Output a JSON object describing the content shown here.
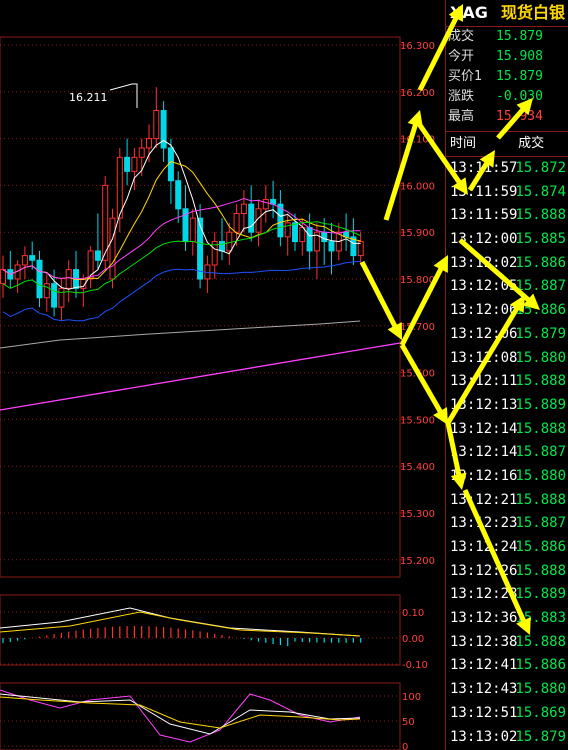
{
  "instrument": {
    "code": "XAG",
    "name": "现货白银"
  },
  "quote": [
    {
      "label": "成交",
      "value": "15.879",
      "color": "green"
    },
    {
      "label": "今开",
      "value": "15.908",
      "color": "green"
    },
    {
      "label": "买价1",
      "value": "15.879",
      "color": "green"
    },
    {
      "label": "涨跌",
      "value": "-0.030",
      "color": "green"
    },
    {
      "label": "最高",
      "value": "15.934",
      "color": "red"
    }
  ],
  "trades_header": {
    "time": "时间",
    "price": "成交"
  },
  "trades": [
    {
      "time": "13:11:57",
      "price": "15.872"
    },
    {
      "time": "13:11:59",
      "price": "15.874"
    },
    {
      "time": "13:11:59",
      "price": "15.888"
    },
    {
      "time": "13:12:00",
      "price": "15.885"
    },
    {
      "time": "13:12:02",
      "price": "15.886"
    },
    {
      "time": "13:12:05",
      "price": "15.887"
    },
    {
      "time": "13:12:06",
      "price": "15.886"
    },
    {
      "time": "13:12:06",
      "price": "15.879"
    },
    {
      "time": "13:12:08",
      "price": "15.880"
    },
    {
      "time": "13:12:11",
      "price": "15.888"
    },
    {
      "time": "13:12:13",
      "price": "15.889"
    },
    {
      "time": "13:12:14",
      "price": "15.888"
    },
    {
      "time": "13:12:14",
      "price": "15.887"
    },
    {
      "time": "13:12:16",
      "price": "15.880"
    },
    {
      "time": "13:12:21",
      "price": "15.888"
    },
    {
      "time": "13:12:23",
      "price": "15.887"
    },
    {
      "time": "13:12:24",
      "price": "15.886"
    },
    {
      "time": "13:12:26",
      "price": "15.888"
    },
    {
      "time": "13:12:28",
      "price": "15.889"
    },
    {
      "time": "13:12:36",
      "price": "15.883"
    },
    {
      "time": "13:12:38",
      "price": "15.888"
    },
    {
      "time": "13:12:41",
      "price": "15.886"
    },
    {
      "time": "13:12:43",
      "price": "15.880"
    },
    {
      "time": "13:12:51",
      "price": "15.869"
    },
    {
      "time": "13:13:02",
      "price": "15.879"
    }
  ],
  "chart_data": {
    "type": "candlestick",
    "price_axis_labels": [
      "16.300",
      "16.200",
      "16.100",
      "16.000",
      "15.900",
      "15.800",
      "15.700",
      "15.600",
      "15.500",
      "15.400",
      "15.300",
      "15.200"
    ],
    "ylim": [
      15.18,
      16.33
    ],
    "high_annotation": "16.211",
    "candles": [
      [
        15.79,
        15.85,
        15.76,
        15.82
      ],
      [
        15.82,
        15.86,
        15.78,
        15.8
      ],
      [
        15.8,
        15.84,
        15.77,
        15.83
      ],
      [
        15.83,
        15.87,
        15.8,
        15.85
      ],
      [
        15.85,
        15.88,
        15.82,
        15.84
      ],
      [
        15.84,
        15.86,
        15.74,
        15.76
      ],
      [
        15.76,
        15.81,
        15.73,
        15.79
      ],
      [
        15.79,
        15.82,
        15.72,
        15.74
      ],
      [
        15.74,
        15.8,
        15.71,
        15.78
      ],
      [
        15.78,
        15.84,
        15.75,
        15.82
      ],
      [
        15.82,
        15.86,
        15.76,
        15.78
      ],
      [
        15.78,
        15.81,
        15.74,
        15.8
      ],
      [
        15.8,
        15.87,
        15.78,
        15.86
      ],
      [
        15.86,
        15.94,
        15.82,
        15.84
      ],
      [
        15.84,
        16.02,
        15.82,
        16.0
      ],
      [
        15.8,
        15.95,
        15.78,
        15.93
      ],
      [
        15.93,
        16.08,
        15.9,
        16.06
      ],
      [
        16.06,
        16.1,
        16.0,
        16.03
      ],
      [
        16.03,
        16.08,
        15.99,
        16.06
      ],
      [
        16.06,
        16.1,
        16.02,
        16.08
      ],
      [
        16.08,
        16.13,
        16.05,
        16.1
      ],
      [
        16.1,
        16.21,
        16.08,
        16.16
      ],
      [
        16.16,
        16.18,
        16.05,
        16.08
      ],
      [
        16.08,
        16.1,
        15.96,
        16.01
      ],
      [
        16.01,
        16.03,
        15.92,
        15.95
      ],
      [
        15.95,
        16.0,
        15.86,
        15.88
      ],
      [
        15.88,
        15.95,
        15.85,
        15.93
      ],
      [
        15.93,
        15.96,
        15.78,
        15.8
      ],
      [
        15.8,
        15.85,
        15.77,
        15.83
      ],
      [
        15.83,
        15.9,
        15.8,
        15.88
      ],
      [
        15.88,
        15.93,
        15.84,
        15.86
      ],
      [
        15.86,
        15.92,
        15.83,
        15.9
      ],
      [
        15.9,
        15.96,
        15.87,
        15.94
      ],
      [
        15.94,
        15.99,
        15.9,
        15.96
      ],
      [
        15.96,
        16.0,
        15.88,
        15.9
      ],
      [
        15.9,
        15.97,
        15.87,
        15.95
      ],
      [
        15.95,
        16.0,
        15.92,
        15.97
      ],
      [
        15.97,
        16.01,
        15.93,
        15.96
      ],
      [
        15.96,
        15.99,
        15.87,
        15.89
      ],
      [
        15.89,
        15.94,
        15.85,
        15.92
      ],
      [
        15.92,
        15.94,
        15.86,
        15.88
      ],
      [
        15.88,
        15.93,
        15.85,
        15.91
      ],
      [
        15.91,
        15.94,
        15.82,
        15.86
      ],
      [
        15.86,
        15.92,
        15.8,
        15.9
      ],
      [
        15.9,
        15.93,
        15.83,
        15.88
      ],
      [
        15.88,
        15.92,
        15.81,
        15.86
      ],
      [
        15.86,
        15.92,
        15.84,
        15.9
      ],
      [
        15.9,
        15.94,
        15.86,
        15.89
      ],
      [
        15.89,
        15.93,
        15.83,
        15.85
      ],
      [
        15.85,
        15.9,
        15.83,
        15.88
      ]
    ],
    "macd_axis_labels": [
      "0.10",
      "0.00",
      "-0.10"
    ],
    "kdj_axis_labels": [
      "100",
      "50",
      "0"
    ]
  },
  "colors": {
    "up": "#ff3030",
    "down": "#00d8e8",
    "grid": "#8b1a1a",
    "axis_text": "#ff4040",
    "ma5": "#ffffff",
    "ma10": "#ffd700",
    "ma20": "#ff40ff",
    "ma30": "#00e000",
    "ma60": "#2050ff",
    "ma120": "#aaaaaa",
    "arrow": "#ffff00"
  }
}
